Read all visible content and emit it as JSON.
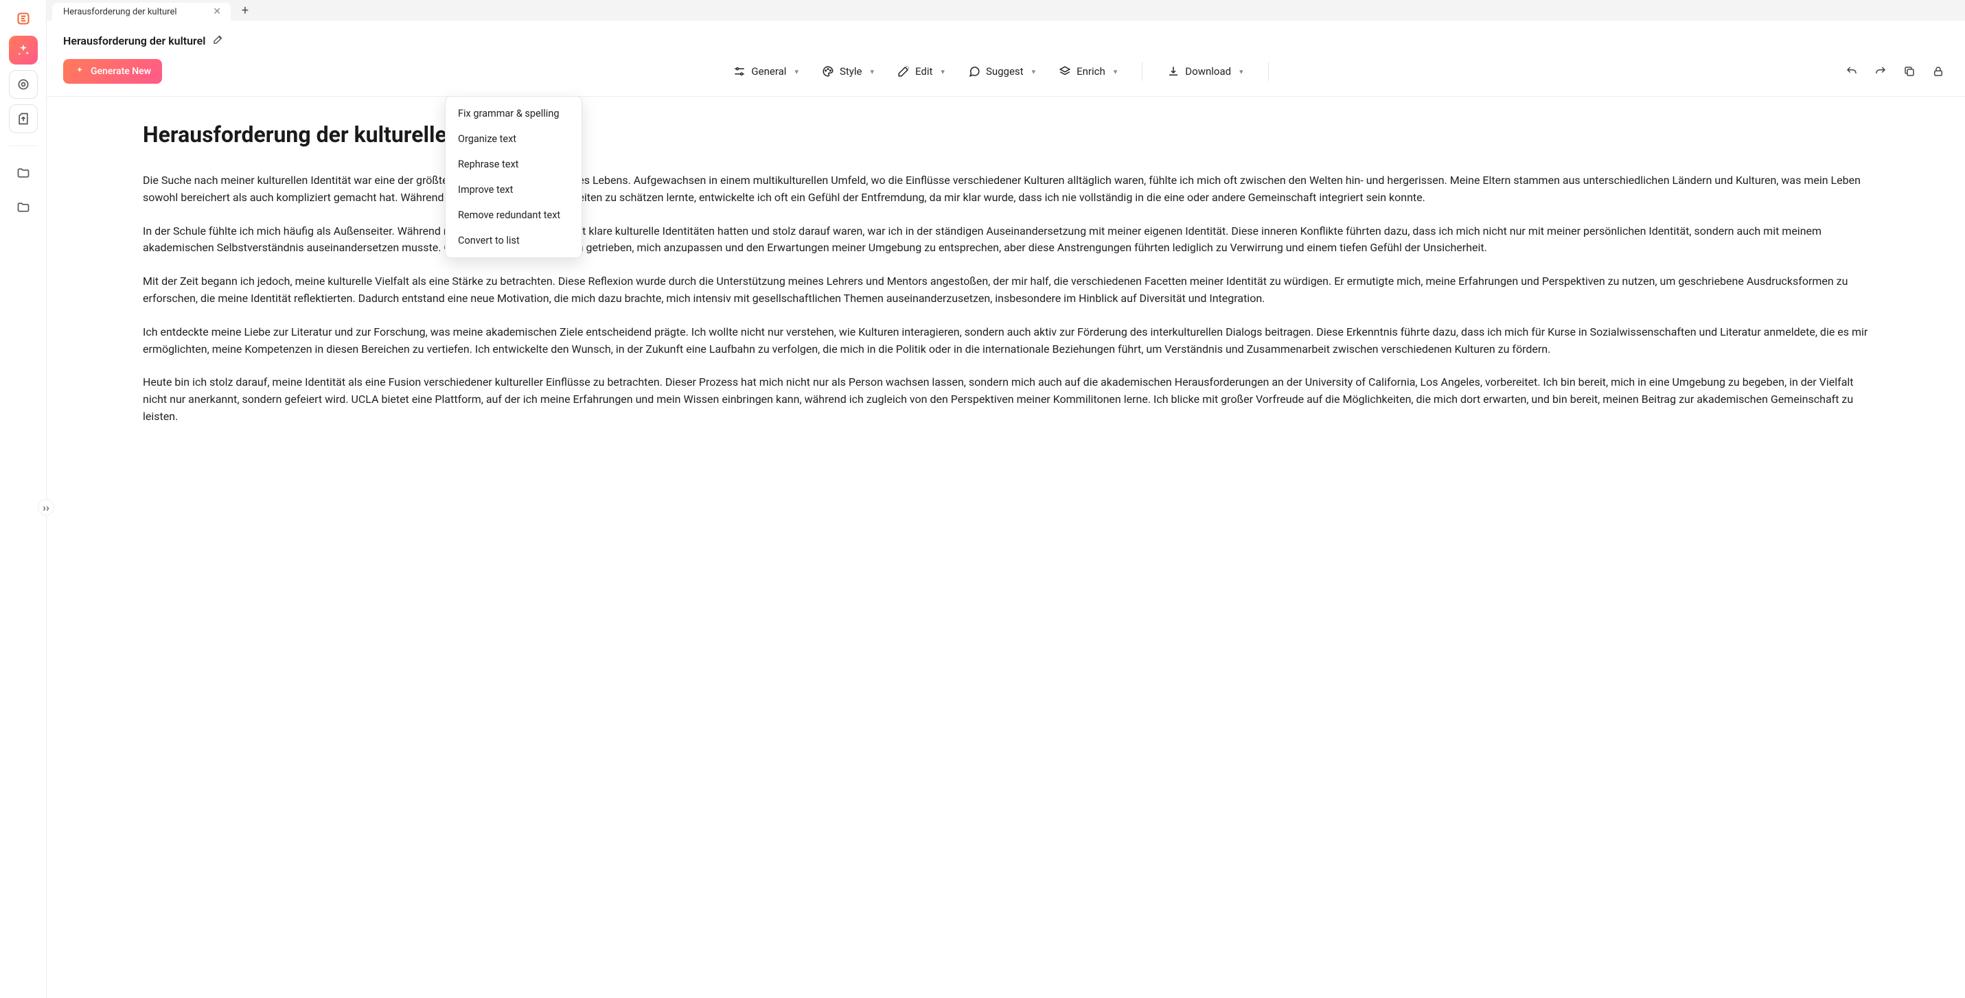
{
  "tab": {
    "title": "Herausforderung der kulturel"
  },
  "doc": {
    "title_short": "Herausforderung der kulturel",
    "heading": "Herausforderung der kulturellen",
    "paragraphs": [
      "Die Suche nach meiner kulturellen Identität war eine der größten Herausforderungen meines Lebens. Aufgewachsen in einem multikulturellen Umfeld, wo die Einflüsse verschiedener Kulturen alltäglich waren, fühlte ich mich oft zwischen den Welten hin- und hergerissen. Meine Eltern stammen aus unterschiedlichen Ländern und Kulturen, was mein Leben sowohl bereichert als auch kompliziert gemacht hat. Während ich die Traditionen beider Seiten zu schätzen lernte, entwickelte ich oft ein Gefühl der Entfremdung, da mir klar wurde, dass ich nie vollständig in die eine oder andere Gemeinschaft integriert sein konnte.",
      "In der Schule fühlte ich mich häufig als Außenseiter. Während meine Klassenkameraden oft klare kulturelle Identitäten hatten und stolz darauf waren, war ich in der ständigen Auseinandersetzung mit meiner eigenen Identität. Diese inneren Konflikte führten dazu, dass ich mich nicht nur mit meiner persönlichen Identität, sondern auch mit meinem akademischen Selbstverständnis auseinandersetzen musste. Oft war ich von dem Wunsch getrieben, mich anzupassen und den Erwartungen meiner Umgebung zu entsprechen, aber diese Anstrengungen führten lediglich zu Verwirrung und einem tiefen Gefühl der Unsicherheit.",
      "Mit der Zeit begann ich jedoch, meine kulturelle Vielfalt als eine Stärke zu betrachten. Diese Reflexion wurde durch die Unterstützung meines Lehrers und Mentors angestoßen, der mir half, die verschiedenen Facetten meiner Identität zu würdigen. Er ermutigte mich, meine Erfahrungen und Perspektiven zu nutzen, um geschriebene Ausdrucksformen zu erforschen, die meine Identität reflektierten. Dadurch entstand eine neue Motivation, die mich dazu brachte, mich intensiv mit gesellschaftlichen Themen auseinanderzusetzen, insbesondere im Hinblick auf Diversität und Integration.",
      "Ich entdeckte meine Liebe zur Literatur und zur Forschung, was meine akademischen Ziele entscheidend prägte. Ich wollte nicht nur verstehen, wie Kulturen interagieren, sondern auch aktiv zur Förderung des interkulturellen Dialogs beitragen. Diese Erkenntnis führte dazu, dass ich mich für Kurse in Sozialwissenschaften und Literatur anmeldete, die es mir ermöglichten, meine Kompetenzen in diesen Bereichen zu vertiefen. Ich entwickelte den Wunsch, in der Zukunft eine Laufbahn zu verfolgen, die mich in die Politik oder in die internationale Beziehungen führt, um Verständnis und Zusammenarbeit zwischen verschiedenen Kulturen zu fördern.",
      "Heute bin ich stolz darauf, meine Identität als eine Fusion verschiedener kultureller Einflüsse zu betrachten. Dieser Prozess hat mich nicht nur als Person wachsen lassen, sondern mich auch auf die akademischen Herausforderungen an der University of California, Los Angeles, vorbereitet. Ich bin bereit, mich in eine Umgebung zu begeben, in der Vielfalt nicht nur anerkannt, sondern gefeiert wird. UCLA bietet eine Plattform, auf der ich meine Erfahrungen und mein Wissen einbringen kann, während ich zugleich von den Perspektiven meiner Kommilitonen lerne. Ich blicke mit großer Vorfreude auf die Möglichkeiten, die mich dort erwarten, und bin bereit, meinen Beitrag zur akademischen Gemeinschaft zu leisten."
    ]
  },
  "buttons": {
    "generate": "Generate New",
    "general": "General",
    "style": "Style",
    "edit": "Edit",
    "suggest": "Suggest",
    "enrich": "Enrich",
    "download": "Download"
  },
  "edit_menu": {
    "fix": "Fix grammar & spelling",
    "organize": "Organize text",
    "rephrase": "Rephrase text",
    "improve": "Improve text",
    "remove": "Remove redundant text",
    "convert": "Convert to list"
  }
}
